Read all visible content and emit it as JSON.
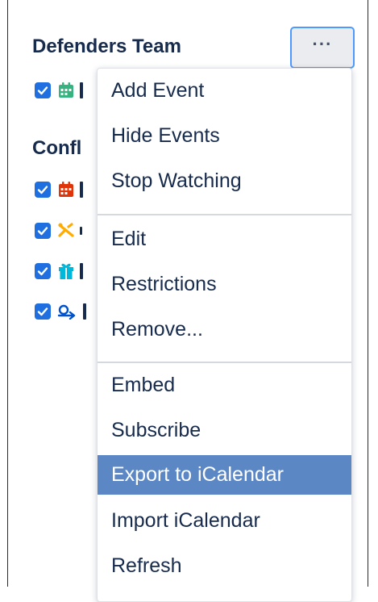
{
  "sections": [
    {
      "title": "Defenders Team",
      "more_button_label": "···",
      "calendars": [
        {
          "checked": true,
          "icon": "calendar-green-icon",
          "color": "#36b37e"
        }
      ]
    },
    {
      "title": "Confl",
      "calendars": [
        {
          "checked": true,
          "icon": "calendar-red-icon",
          "color": "#de350b"
        },
        {
          "checked": true,
          "icon": "plane-orange-icon",
          "color": "#ffab00"
        },
        {
          "checked": true,
          "icon": "gift-teal-icon",
          "color": "#00b8d9"
        },
        {
          "checked": true,
          "icon": "travel-blue-icon",
          "color": "#0052cc"
        }
      ]
    }
  ],
  "menu": {
    "groups": [
      [
        "Add Event",
        "Hide Events",
        "Stop Watching"
      ],
      [
        "Edit",
        "Restrictions",
        "Remove..."
      ],
      [
        "Embed",
        "Subscribe",
        "Export to iCalendar",
        "Import iCalendar",
        "Refresh"
      ]
    ],
    "active_item": "Export to iCalendar"
  },
  "colors": {
    "checkbox": "#1f6fe0",
    "menu_highlight": "#5b87c5",
    "focus_ring": "#4c9aff",
    "text": "#172b4d"
  }
}
